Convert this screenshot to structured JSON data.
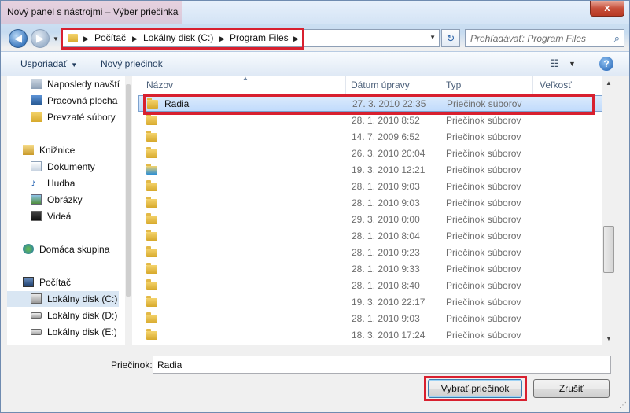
{
  "window": {
    "title": "Nový panel s nástrojmi – Výber priečinka",
    "close_label": "x"
  },
  "address": {
    "crumbs": [
      "Počítač",
      "Lokálny disk (C:)",
      "Program Files"
    ]
  },
  "search": {
    "placeholder": "Prehľadávať: Program Files"
  },
  "toolbar": {
    "organize_label": "Usporiadať",
    "new_folder_label": "Nový priečinok",
    "help_label": "?"
  },
  "nav": {
    "items": [
      {
        "label": "Naposledy navští",
        "icon": "recent-places-icon"
      },
      {
        "label": "Pracovná plocha",
        "icon": "desktop-icon"
      },
      {
        "label": "Prevzaté súbory",
        "icon": "downloads-icon"
      },
      {
        "label": "Knižnice",
        "icon": "libraries-icon"
      },
      {
        "label": "Dokumenty",
        "icon": "documents-icon"
      },
      {
        "label": "Hudba",
        "icon": "music-icon"
      },
      {
        "label": "Obrázky",
        "icon": "pictures-icon"
      },
      {
        "label": "Videá",
        "icon": "videos-icon"
      },
      {
        "label": "Domáca skupina",
        "icon": "homegroup-icon"
      },
      {
        "label": "Počítač",
        "icon": "computer-icon"
      },
      {
        "label": "Lokálny disk (C:)",
        "icon": "drive-c-icon"
      },
      {
        "label": "Lokálny disk (D:)",
        "icon": "drive-icon"
      },
      {
        "label": "Lokálny disk (E:)",
        "icon": "drive-icon"
      }
    ]
  },
  "columns": {
    "name": "Názov",
    "date": "Dátum úpravy",
    "type": "Typ",
    "size": "Veľkosť"
  },
  "files": [
    {
      "name": "Radia",
      "date": "27. 3. 2010 22:35",
      "type": "Priečinok súborov"
    },
    {
      "name": "",
      "date": "28. 1. 2010 8:52",
      "type": "Priečinok súborov"
    },
    {
      "name": "",
      "date": "14. 7. 2009 6:52",
      "type": "Priečinok súborov"
    },
    {
      "name": "",
      "date": "26. 3. 2010 20:04",
      "type": "Priečinok súborov"
    },
    {
      "name": "",
      "date": "19. 3. 2010 12:21",
      "type": "Priečinok súborov"
    },
    {
      "name": "",
      "date": "28. 1. 2010 9:03",
      "type": "Priečinok súborov"
    },
    {
      "name": "",
      "date": "28. 1. 2010 9:03",
      "type": "Priečinok súborov"
    },
    {
      "name": "",
      "date": "29. 3. 2010 0:00",
      "type": "Priečinok súborov"
    },
    {
      "name": "",
      "date": "28. 1. 2010 8:04",
      "type": "Priečinok súborov"
    },
    {
      "name": "",
      "date": "28. 1. 2010 9:23",
      "type": "Priečinok súborov"
    },
    {
      "name": "",
      "date": "28. 1. 2010 9:33",
      "type": "Priečinok súborov"
    },
    {
      "name": "",
      "date": "28. 1. 2010 8:40",
      "type": "Priečinok súborov"
    },
    {
      "name": "",
      "date": "19. 3. 2010 22:17",
      "type": "Priečinok súborov"
    },
    {
      "name": "",
      "date": "28. 1. 2010 9:03",
      "type": "Priečinok súborov"
    },
    {
      "name": "",
      "date": "18. 3. 2010 17:24",
      "type": "Priečinok súborov"
    }
  ],
  "footer": {
    "folder_label": "Priečinok:",
    "folder_value": "Radia",
    "select_label": "Vybrať priečinok",
    "cancel_label": "Zrušiť"
  },
  "colors": {
    "highlight": "#d8202f",
    "selection": "#c1dbfc"
  }
}
